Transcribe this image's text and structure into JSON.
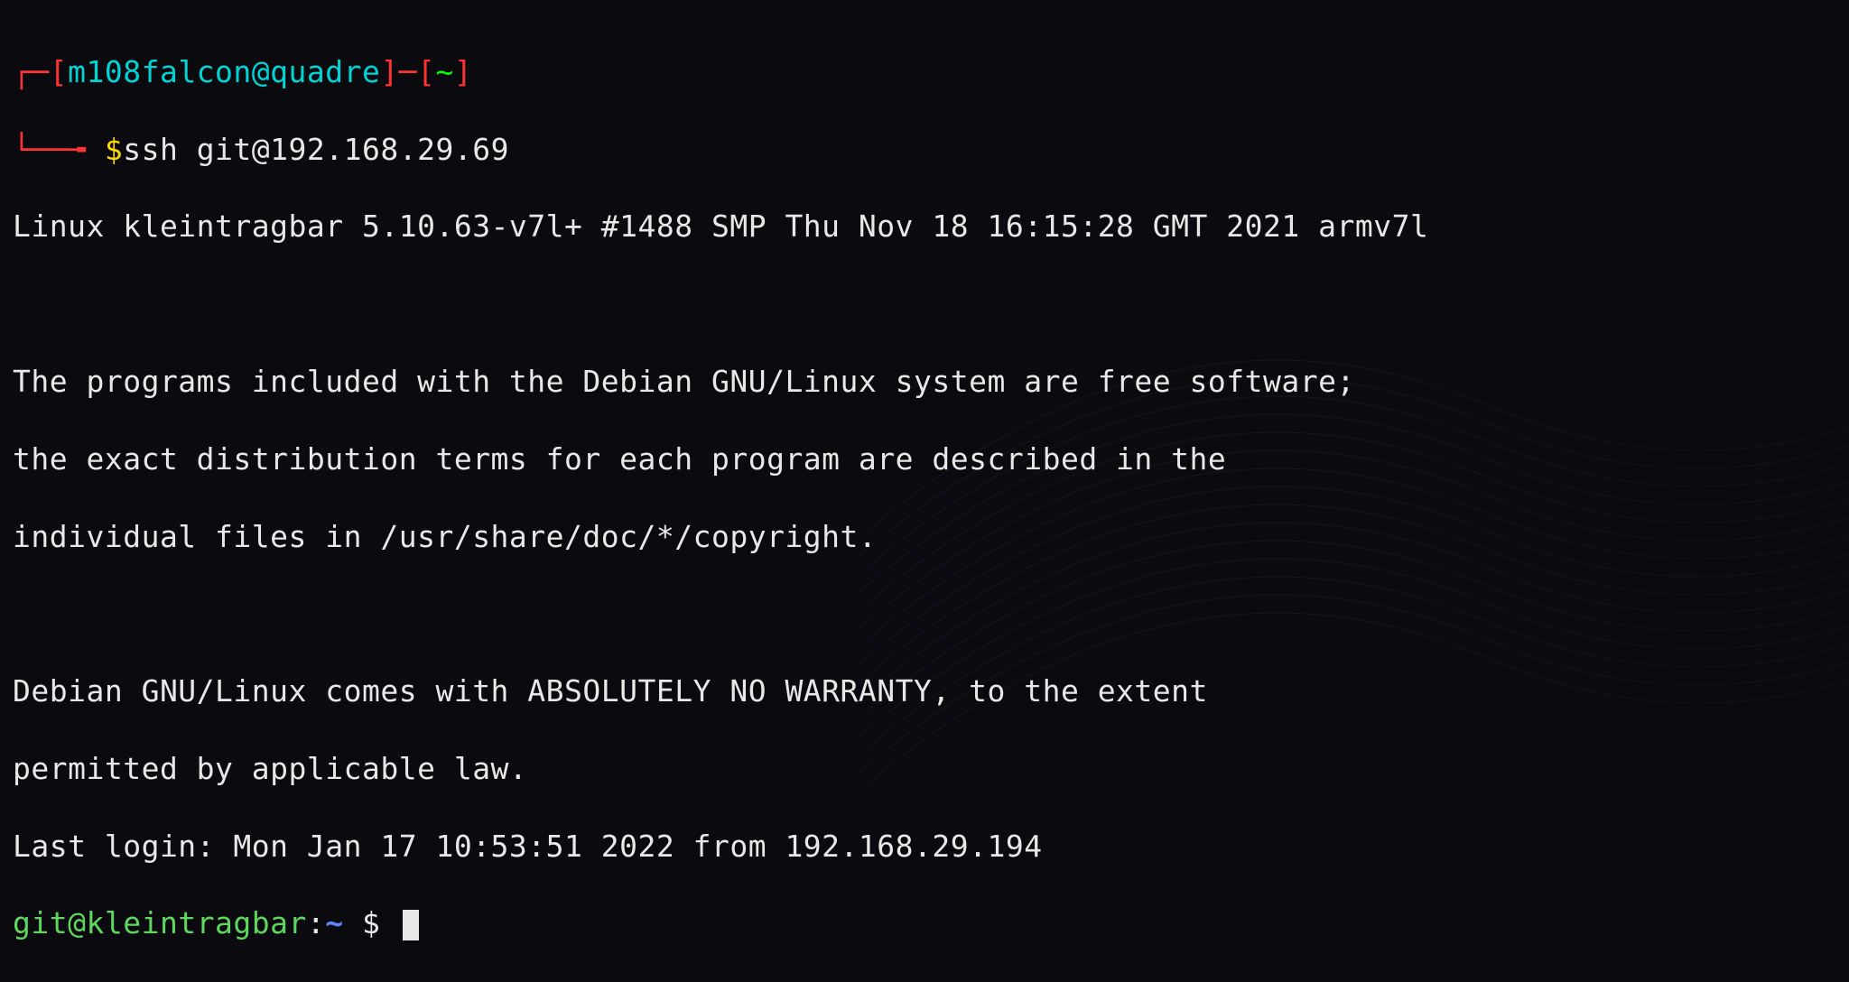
{
  "prompt1": {
    "bracket_open1": "┌─[",
    "user": "m108falcon",
    "at": "@",
    "host": "quadre",
    "bracket_close1": "]",
    "dash": "─",
    "bracket_open2": "[",
    "cwd": "~",
    "bracket_close2": "]",
    "line2_prefix": "└──╼ ",
    "dollar": "$",
    "command": "ssh git@192.168.29.69"
  },
  "motd": {
    "uname": "Linux kleintragbar 5.10.63-v7l+ #1488 SMP Thu Nov 18 16:15:28 GMT 2021 armv7l",
    "blank1": "",
    "para1_l1": "The programs included with the Debian GNU/Linux system are free software;",
    "para1_l2": "the exact distribution terms for each program are described in the",
    "para1_l3": "individual files in /usr/share/doc/*/copyright.",
    "blank2": "",
    "para2_l1": "Debian GNU/Linux comes with ABSOLUTELY NO WARRANTY, to the extent",
    "para2_l2": "permitted by applicable law.",
    "lastlogin": "Last login: Mon Jan 17 10:53:51 2022 from 192.168.29.194"
  },
  "prompt2": {
    "userhost": "git@kleintragbar",
    "colon": ":",
    "cwd": "~",
    "dollar": " $ "
  }
}
